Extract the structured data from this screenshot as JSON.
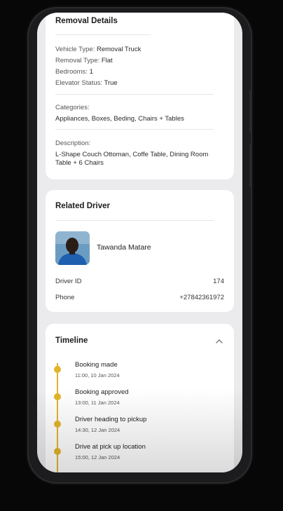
{
  "removal_details": {
    "title": "Removal Details",
    "vehicle_type_label": "Vehicle Type:",
    "vehicle_type_value": "Removal Truck",
    "removal_type_label": "Removal Type:",
    "removal_type_value": "Flat",
    "bedrooms_label": "Bedrooms:",
    "bedrooms_value": "1",
    "elevator_label": "Elevator Status:",
    "elevator_value": "True",
    "categories_label": "Categories:",
    "categories_value": "Appliances, Boxes, Beding, Chairs + Tables",
    "description_label": "Description:",
    "description_line1": "L-Shape Couch Ottoman, Coffe Table, Dining Room",
    "description_line2": "Table + 6 Chairs"
  },
  "related_driver": {
    "title": "Related Driver",
    "driver_name": "Tawanda Matare",
    "driver_id_label": "Driver ID",
    "driver_id_value": "174",
    "phone_label": "Phone",
    "phone_value": "+27842361972"
  },
  "timeline": {
    "title": "Timeline",
    "events": [
      {
        "title": "Booking made",
        "time": "11:00, 10 Jan 2024"
      },
      {
        "title": "Booking approved",
        "time": "13:00, 11 Jan 2024"
      },
      {
        "title": "Driver heading to pickup",
        "time": "14:30, 12 Jan 2024"
      },
      {
        "title": "Drive at pick up location",
        "time": "15:00, 12 Jan 2024"
      }
    ]
  },
  "icons": {
    "collapse": "chevron-up-icon"
  },
  "colors": {
    "background": "#070707",
    "screen": "#ebebed",
    "card": "#ffffff",
    "timeline_accent": "#e3b428"
  }
}
